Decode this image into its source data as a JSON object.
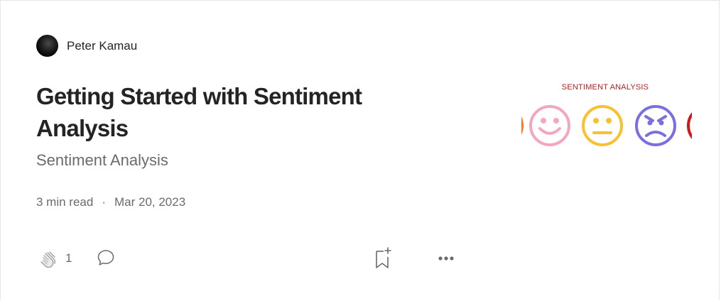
{
  "author": {
    "name": "Peter Kamau"
  },
  "post": {
    "title": "Getting Started with Sentiment Analysis",
    "subtitle": "Sentiment Analysis",
    "read_time": "3 min read",
    "separator": "·",
    "date": "Mar 20, 2023"
  },
  "actions": {
    "clap_count": "1",
    "icons": [
      "clap-icon",
      "comment-icon",
      "bookmark-add-icon",
      "more-icon"
    ]
  },
  "thumbnail": {
    "title": "SENTIMENT ANALYSIS",
    "faces": [
      "happy",
      "neutral",
      "angry"
    ],
    "colors": {
      "happy": "#f4a6c0",
      "neutral": "#fbc02d",
      "angry": "#7a6fe0",
      "left_edge": "#f07a2a",
      "right_edge": "#d01818",
      "title": "#b22222"
    }
  },
  "colors": {
    "text": "#242424",
    "muted": "#6b6b6b",
    "border": "#e6e6e6"
  }
}
